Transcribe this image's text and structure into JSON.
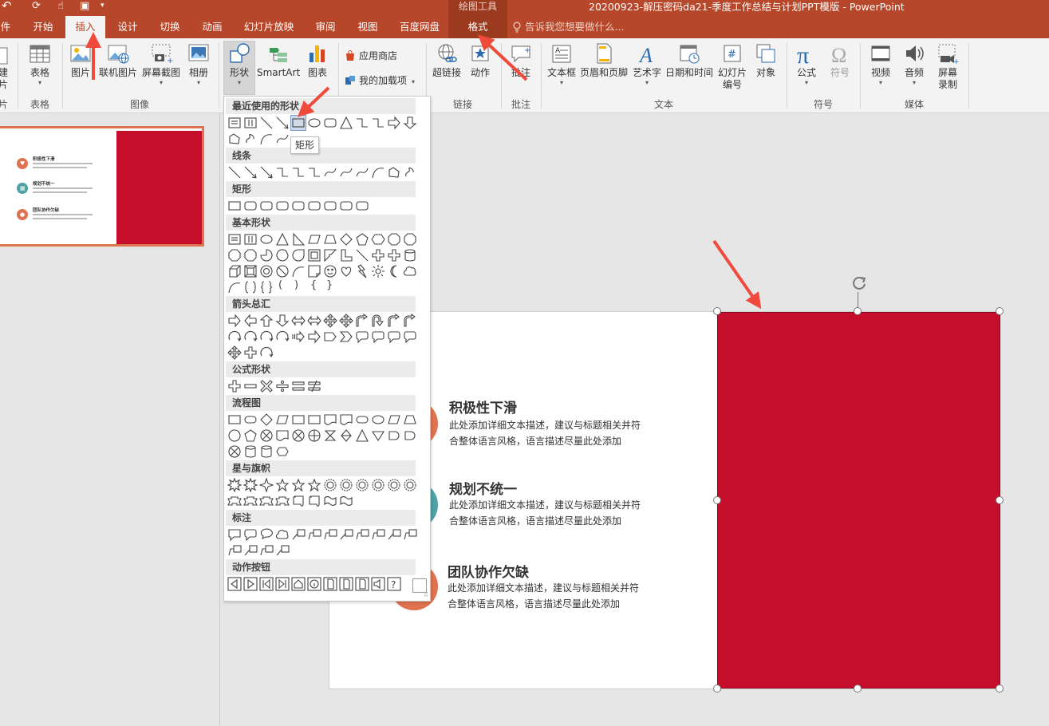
{
  "titlebar": {
    "context_group": "绘图工具",
    "doc_title": "20200923-解压密码da21-季度工作总结与计划PPT模版 - PowerPoint",
    "tell_me": "告诉我您想要做什么...",
    "tabs": [
      {
        "label": "件"
      },
      {
        "label": "开始"
      },
      {
        "label": "插入"
      },
      {
        "label": "设计"
      },
      {
        "label": "切换"
      },
      {
        "label": "动画"
      },
      {
        "label": "幻灯片放映"
      },
      {
        "label": "审阅"
      },
      {
        "label": "视图"
      },
      {
        "label": "百度网盘"
      },
      {
        "label": "格式"
      }
    ]
  },
  "ribbon": {
    "left_cut": {
      "line1": "建",
      "line2": "片",
      "group": "片"
    },
    "table": "表格",
    "group_table": "表格",
    "picture": "图片",
    "online_picture": "联机图片",
    "screenshot": "屏幕截图",
    "album": "相册",
    "group_images": "图像",
    "shapes": "形状",
    "smartart": "SmartArt",
    "chart": "图表",
    "store": "应用商店",
    "my_addins": "我的加载项",
    "hyperlink": "超链接",
    "action": "动作",
    "group_links": "链接",
    "comment": "批注",
    "group_comments": "批注",
    "textbox": "文本框",
    "header_footer": "页眉和页脚",
    "wordart": "艺术字",
    "datetime": "日期和时间",
    "slide_number_l1": "幻灯片",
    "slide_number_l2": "编号",
    "object": "对象",
    "group_text": "文本",
    "equation": "公式",
    "symbol": "符号",
    "group_symbols": "符号",
    "video": "视频",
    "audio": "音频",
    "screen_record_l1": "屏幕",
    "screen_record_l2": "录制",
    "group_media": "媒体"
  },
  "gallery": {
    "sections": [
      "最近使用的形状",
      "线条",
      "矩形",
      "基本形状",
      "箭头总汇",
      "公式形状",
      "流程图",
      "星与旗帜",
      "标注",
      "动作按钮"
    ],
    "basic_text": [
      "(",
      ")",
      "{",
      "}"
    ],
    "tooltip": "矩形"
  },
  "thumbnail": {
    "items": [
      "积极性下滑",
      "规划不统一",
      "团队协作欠缺"
    ]
  },
  "slide": {
    "items": [
      {
        "title": "积极性下滑",
        "desc1": "此处添加详细文本描述，建议与标题相关并符",
        "desc2": "合整体语言风格，语言描述尽量此处添加"
      },
      {
        "title": "规划不统一",
        "desc1": "此处添加详细文本描述，建议与标题相关并符",
        "desc2": "合整体语言风格，语言描述尽量此处添加"
      },
      {
        "title": "团队协作欠缺",
        "desc1": "此处添加详细文本描述，建议与标题相关并符",
        "desc2": "合整体语言风格，语言描述尽量此处添加"
      }
    ]
  },
  "colors": {
    "accent": "#b7472a",
    "shape_fill": "#c50d2c",
    "orange": "#e0734f",
    "teal": "#4fa1a6",
    "annotation_arrow": "#f04a3c"
  }
}
